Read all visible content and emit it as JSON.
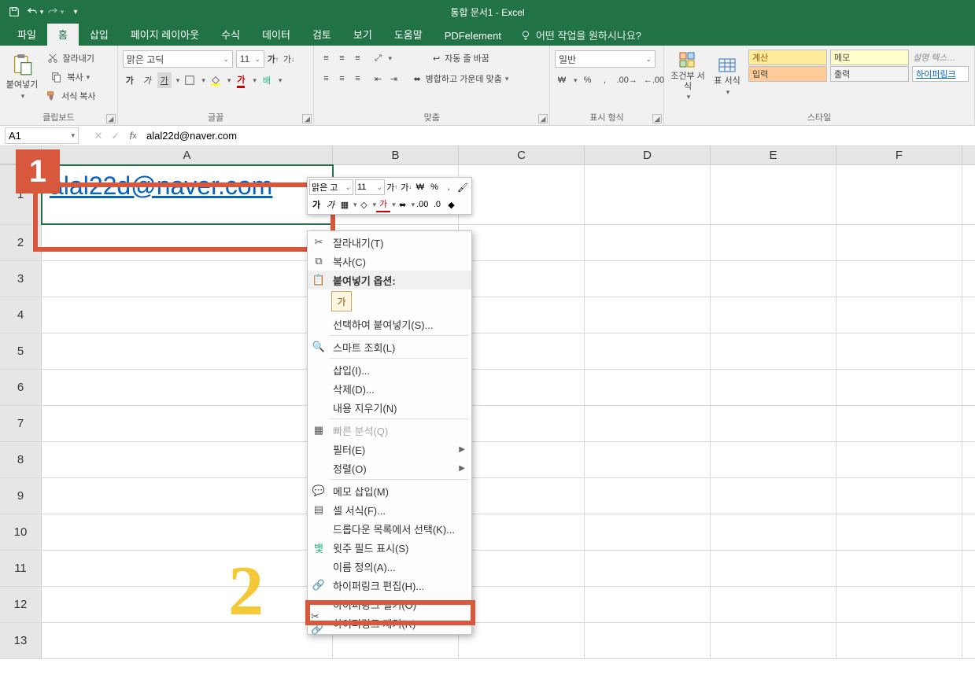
{
  "titlebar": {
    "title": "통합 문서1  -  Excel"
  },
  "tabs": {
    "file": "파일",
    "home": "홈",
    "insert": "삽입",
    "layout": "페이지 레이아웃",
    "formulas": "수식",
    "data": "데이터",
    "review": "검토",
    "view": "보기",
    "help": "도움말",
    "pdf": "PDFelement",
    "tellme": "어떤 작업을 원하시나요?"
  },
  "ribbon": {
    "clipboard": {
      "paste": "붙여넣기",
      "cut": "잘라내기",
      "copy": "복사",
      "format_painter": "서식 복사",
      "label": "클립보드"
    },
    "font": {
      "name": "맑은 고딕",
      "size": "11",
      "bold": "가",
      "italic": "가",
      "under": "가",
      "label": "글꼴"
    },
    "align": {
      "wrap": "자동 줄 바꿈",
      "merge": "병합하고 가운데 맞춤",
      "label": "맞춤"
    },
    "number": {
      "format": "일반",
      "label": "표시 형식"
    },
    "styles_group": {
      "cond": "조건부 서식",
      "table": "표 서식",
      "calc": "계산",
      "memo": "메모",
      "input": "입력",
      "output": "출력",
      "desc": "설명 텍스…",
      "link": "하이퍼링크",
      "label": "스타일"
    }
  },
  "formula_bar": {
    "name": "A1",
    "value": "alal22d@naver.com"
  },
  "grid": {
    "cols": [
      "A",
      "B",
      "C",
      "D",
      "E",
      "F"
    ],
    "rows": [
      "1",
      "2",
      "3",
      "4",
      "5",
      "6",
      "7",
      "8",
      "9",
      "10",
      "11",
      "12",
      "13"
    ],
    "a1": "alal22d@naver.com"
  },
  "mini": {
    "font": "맑은 고",
    "size": "11"
  },
  "ctx": {
    "cut": "잘라내기(T)",
    "copy": "복사(C)",
    "paste_opts": "붙여넣기 옵션:",
    "paste_special": "선택하여 붙여넣기(S)...",
    "smart_lookup": "스마트 조회(L)",
    "insert": "삽입(I)...",
    "delete": "삭제(D)...",
    "clear": "내용 지우기(N)",
    "quick": "빠른 분석(Q)",
    "filter": "필터(E)",
    "sort": "정렬(O)",
    "comment": "메모 삽입(M)",
    "format": "셀 서식(F)...",
    "dropdown": "드롭다운 목록에서 선택(K)...",
    "phonetic": "윗주 필드 표시(S)",
    "define_name": "이름 정의(A)...",
    "edit_link": "하이퍼링크 편집(H)...",
    "open_link": "하이퍼링크 열기(O)",
    "remove_link": "하이퍼링크 제거(R)"
  }
}
